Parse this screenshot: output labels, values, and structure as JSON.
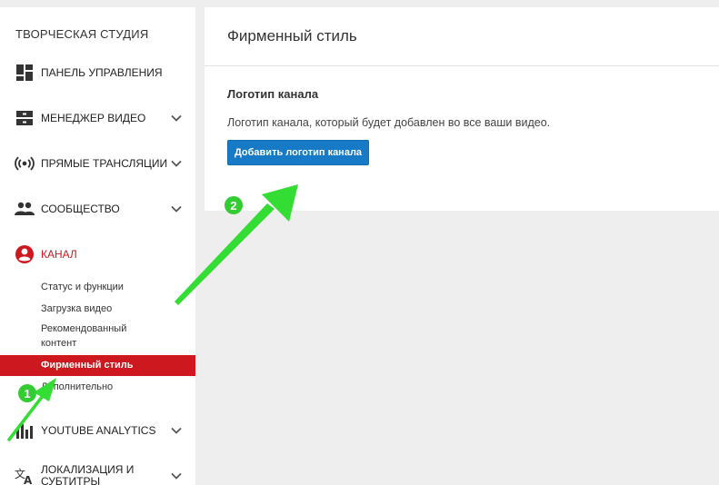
{
  "sidebar": {
    "studio_title": "ТВОРЧЕСКАЯ СТУДИЯ",
    "items": [
      {
        "label": "ПАНЕЛЬ УПРАВЛЕНИЯ",
        "icon": "dashboard-icon"
      },
      {
        "label": "МЕНЕДЖЕР ВИДЕО",
        "icon": "video-manager-icon",
        "expandable": true
      },
      {
        "label": "ПРЯМЫЕ ТРАНСЛЯЦИИ",
        "icon": "live-broadcast-icon",
        "expandable": true
      },
      {
        "label": "СООБЩЕСТВО",
        "icon": "community-icon",
        "expandable": true
      },
      {
        "label": "КАНАЛ",
        "icon": "channel-icon",
        "active": true
      },
      {
        "label": "YOUTUBE ANALYTICS",
        "icon": "analytics-icon",
        "expandable": true
      },
      {
        "label_line1": "ЛОКАЛИЗАЦИЯ И",
        "label_line2": "СУБТИТРЫ",
        "icon": "translate-icon",
        "expandable": true
      }
    ],
    "channel_sub_items": [
      {
        "label": "Статус и функции"
      },
      {
        "label": "Загрузка видео"
      },
      {
        "label_line1": "Рекомендованный",
        "label_line2": "контент"
      },
      {
        "label": "Фирменный стиль",
        "selected": true
      },
      {
        "label": "Дополнительно"
      }
    ]
  },
  "main": {
    "page_title": "Фирменный стиль",
    "section_title": "Логотип канала",
    "section_description": "Логотип канала, который будет добавлен во все ваши видео.",
    "add_logo_button": "Добавить логотип канала"
  },
  "annotations": {
    "badge_1": "1",
    "badge_2": "2",
    "arrow_color": "#33dd33"
  },
  "colors": {
    "accent_red": "#cc181e",
    "button_blue": "#167ac6"
  }
}
